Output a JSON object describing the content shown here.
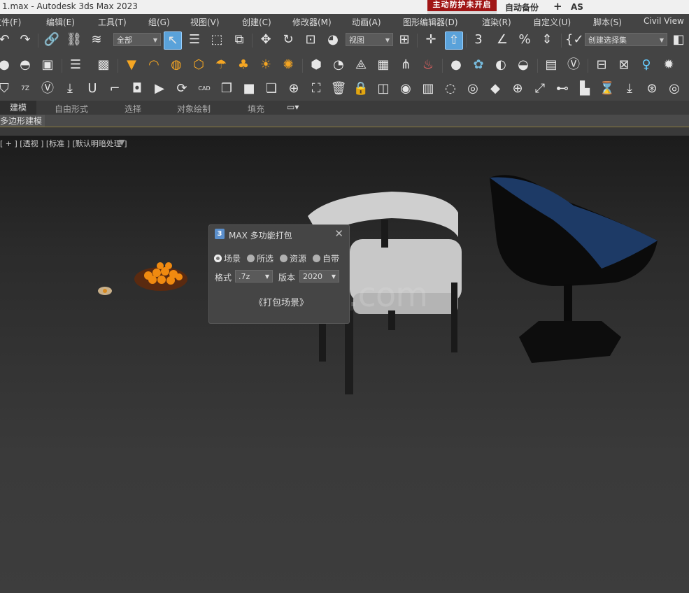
{
  "window": {
    "title": "1.max - Autodesk 3ds Max 2023",
    "warning_badge": "主动防护未开启",
    "autosave": "自动备份",
    "plus": "+",
    "as": "AS"
  },
  "menu": {
    "items": [
      "文件(F)",
      "编辑(E)",
      "工具(T)",
      "组(G)",
      "视图(V)",
      "创建(C)",
      "修改器(M)",
      "动画(A)",
      "图形编辑器(D)",
      "渲染(R)",
      "自定义(U)",
      "脚本(S)",
      "Civil View"
    ]
  },
  "toolbar": {
    "filter_value": "全部",
    "coord_value": "视图",
    "selection_set_placeholder": "创建选择集",
    "snap_label": "3"
  },
  "ribbon": {
    "tabs": [
      "建模",
      "自由形式",
      "选择",
      "对象绘制",
      "填充"
    ],
    "panel_title": "多边形建模"
  },
  "viewport": {
    "label": "[ + ] [透视 ] [标准 ] [默认明暗处理 ]",
    "watermark": "IAIModel.com"
  },
  "dialog": {
    "logo": "3",
    "title": "MAX 多功能打包",
    "close": "✕",
    "radios": [
      "场景",
      "所选",
      "资源",
      "自带"
    ],
    "format_label": "格式",
    "format_value": ".7z",
    "version_label": "版本",
    "version_value": "2020",
    "pack_button": "《打包场景》"
  }
}
